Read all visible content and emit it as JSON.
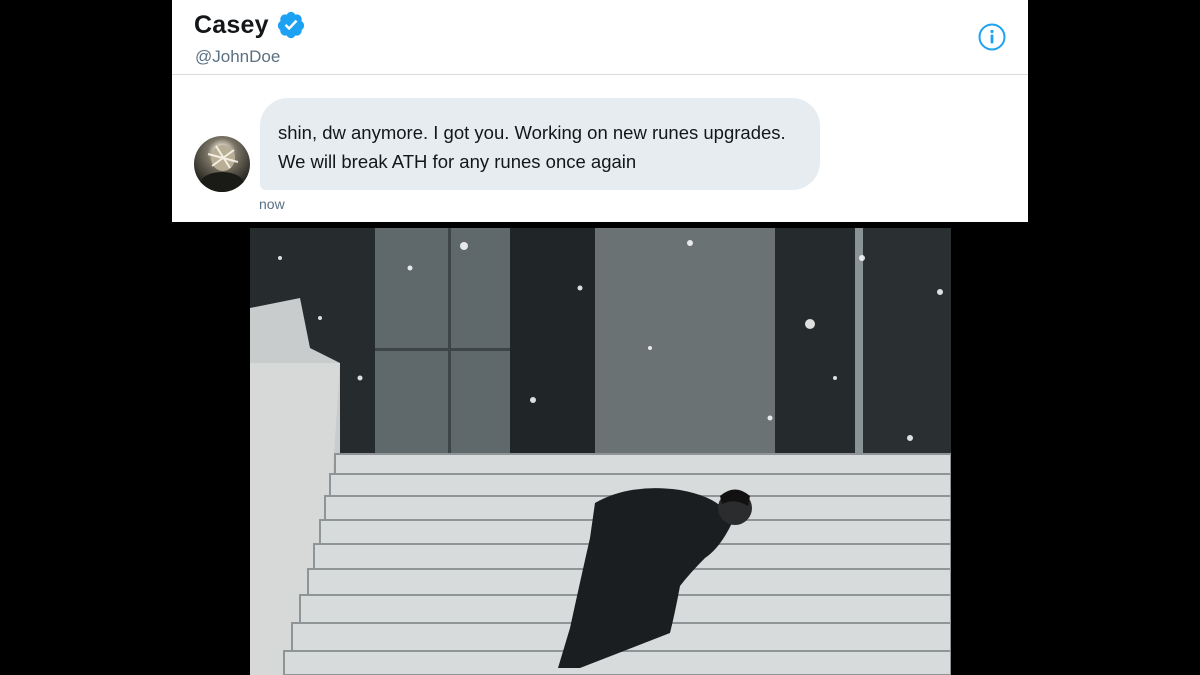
{
  "tweet": {
    "author": {
      "display_name": "Casey",
      "handle": "@JohnDoe",
      "verified_icon": "verified-badge-icon",
      "avatar": "avatar"
    },
    "info_icon": "info-icon",
    "message": "shin, dw anymore. I got you. Working on new runes upgrades. We will break ATH for any runes once again",
    "timestamp": "now"
  },
  "media": {
    "description_icon": "video-frame"
  },
  "colors": {
    "accent": "#1da1f2",
    "bubble": "#e6ecf0",
    "text": "#14171a",
    "muted": "#5b7083",
    "background": "#000000"
  }
}
